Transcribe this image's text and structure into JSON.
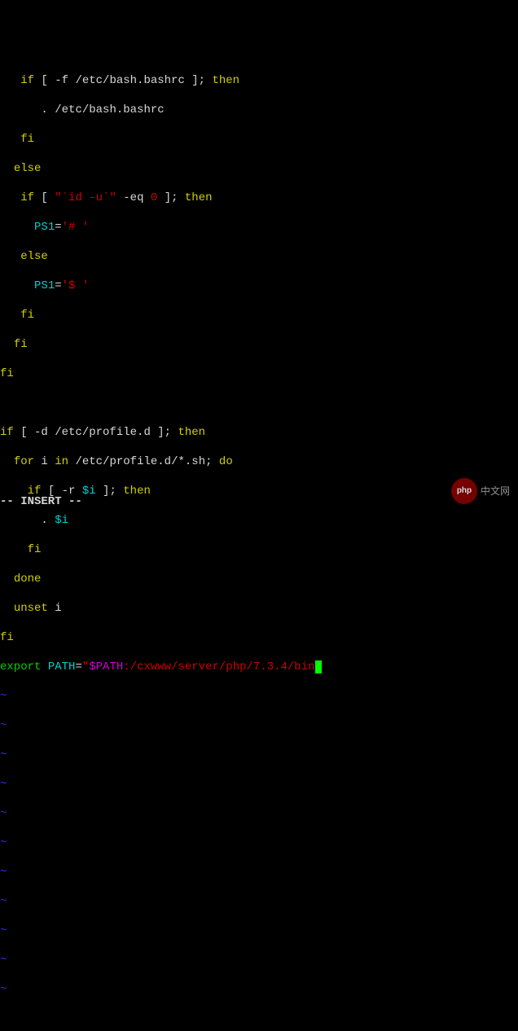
{
  "code": {
    "l1": {
      "ind": "   ",
      "kw": "if",
      "cond": " [ -f /etc/bash.bashrc ]; ",
      "th": "then"
    },
    "l2": {
      "ind": "      ",
      "dot": ". ",
      "path": "/etc/bash.bashrc"
    },
    "l3": {
      "ind": "   ",
      "kw": "fi"
    },
    "l4": {
      "ind": "  ",
      "kw": "else"
    },
    "l5": {
      "ind": "   ",
      "kw": "if",
      "open": " [ ",
      "q1": "\"",
      "cmd": "`id -u`",
      "q2": "\"",
      "eq": " -eq ",
      "num": "0",
      "close": " ]; ",
      "th": "then"
    },
    "l6": {
      "ind": "     ",
      "var": "PS1",
      "eq": "=",
      "str": "'# '"
    },
    "l7": {
      "ind": "   ",
      "kw": "else"
    },
    "l8": {
      "ind": "     ",
      "var": "PS1",
      "eq": "=",
      "str": "'$ '"
    },
    "l9": {
      "ind": "   ",
      "kw": "fi"
    },
    "l10": {
      "ind": "  ",
      "kw": "fi"
    },
    "l11": {
      "kw": "fi"
    },
    "l13": {
      "kw": "if",
      "cond": " [ -d /etc/profile.d ]; ",
      "th": "then"
    },
    "l14": {
      "ind": "  ",
      "kw": "for",
      "var": " i ",
      "in": "in ",
      "path": "/etc/profile.d/*.sh",
      "semi": "; ",
      "do": "do"
    },
    "l15": {
      "ind": "    ",
      "kw": "if",
      "open": " [ -r ",
      "var": "$i",
      "close": " ]; ",
      "th": "then"
    },
    "l16": {
      "ind": "      ",
      "dot": ". ",
      "var": "$i"
    },
    "l17": {
      "ind": "    ",
      "kw": "fi"
    },
    "l18": {
      "ind": "  ",
      "kw": "done"
    },
    "l19": {
      "ind": "  ",
      "kw": "unset",
      "var": " i"
    },
    "l20": {
      "kw": "fi"
    },
    "l21": {
      "kw": "export",
      "sp": " ",
      "var": "PATH",
      "eq": "=",
      "q1": "\"",
      "path": "$PATH",
      "colon": ":",
      "rest": "/cxwww/server/php/7.3.4/bin",
      "q2": "\""
    }
  },
  "tilde": "~",
  "status": "-- INSERT --",
  "watermark": {
    "badge": "php",
    "text": "中文网"
  }
}
